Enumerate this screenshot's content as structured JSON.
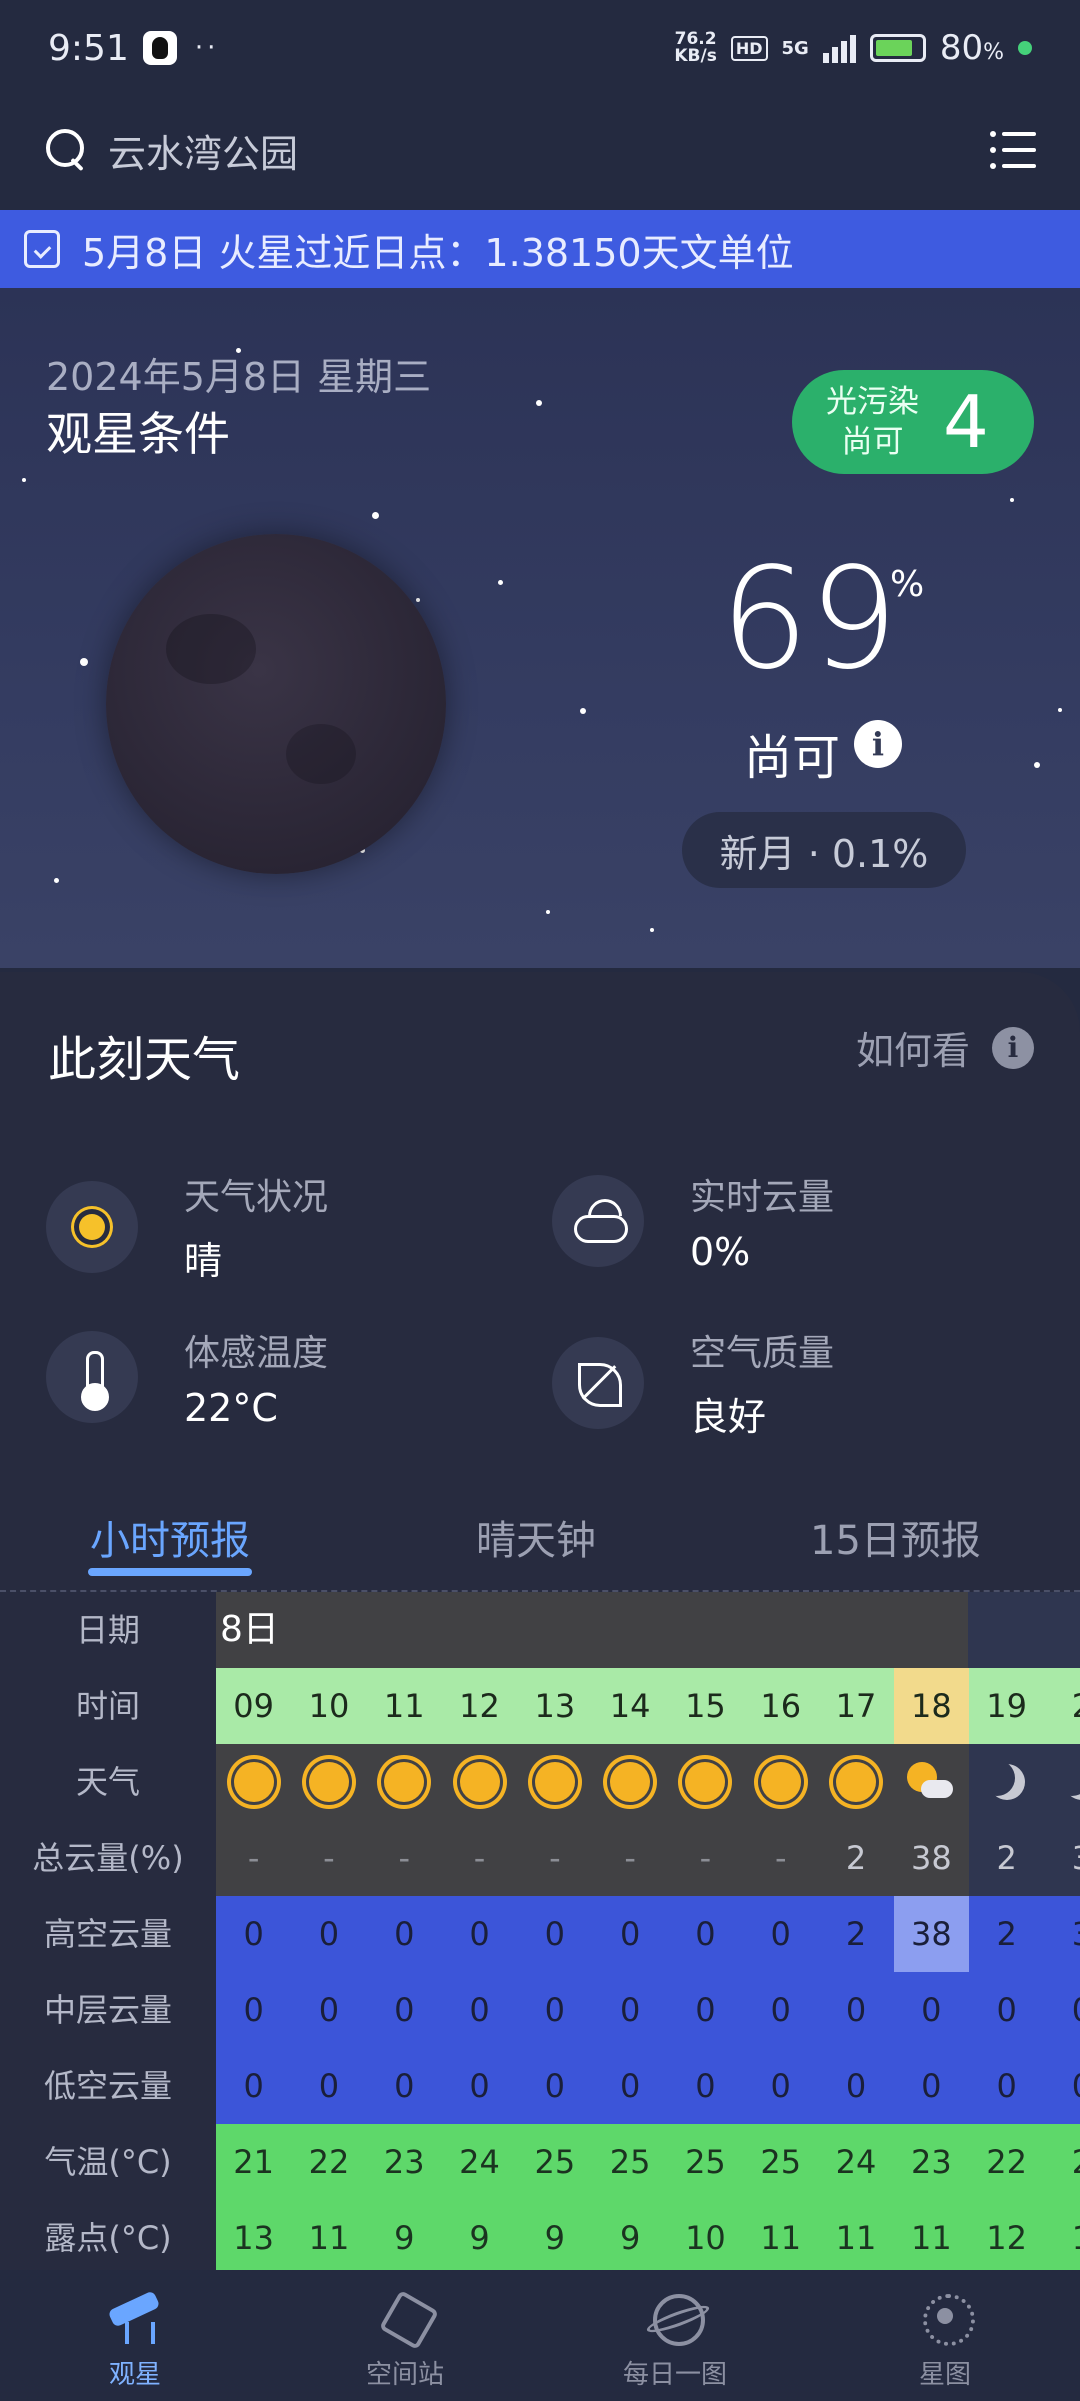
{
  "status_bar": {
    "time": "9:51",
    "dots": "··",
    "net_speed_top": "76.2",
    "net_speed_bottom": "KB/s",
    "hd": "HD",
    "signal": "5G",
    "battery": "80",
    "battery_unit": "%"
  },
  "search": {
    "location": "云水湾公园"
  },
  "banner": {
    "text": "5月8日 火星过近日点：1.38150天文单位"
  },
  "hero": {
    "date": "2024年5月8日 星期三",
    "title": "观星条件",
    "light_pollution_label": "光污染",
    "light_pollution_level": "尚可",
    "light_pollution_value": "4",
    "score": "69",
    "score_unit": "%",
    "score_label": "尚可",
    "info_icon": "i",
    "moon_phase": "新月 · 0.1%"
  },
  "weather": {
    "title": "此刻天气",
    "howto": "如何看",
    "items": [
      {
        "label": "天气状况",
        "value": "晴",
        "icon": "sun-icon"
      },
      {
        "label": "实时云量",
        "value": "0%",
        "icon": "cloud-icon"
      },
      {
        "label": "体感温度",
        "value": "22°C",
        "icon": "thermometer-icon"
      },
      {
        "label": "空气质量",
        "value": "良好",
        "icon": "leaf-icon"
      }
    ]
  },
  "tabs": [
    {
      "label": "小时预报",
      "active": true
    },
    {
      "label": "晴天钟",
      "active": false
    },
    {
      "label": "15日预报",
      "active": false
    }
  ],
  "forecast": {
    "row_labels": [
      "日期",
      "时间",
      "天气",
      "总云量(%)",
      "高空云量",
      "中层云量",
      "低空云量",
      "气温(°C)",
      "露点(°C)"
    ],
    "date": "8日",
    "hours": [
      "09",
      "10",
      "11",
      "12",
      "13",
      "14",
      "15",
      "16",
      "17",
      "18",
      "19",
      "2"
    ],
    "weather": [
      "sun",
      "sun",
      "sun",
      "sun",
      "sun",
      "sun",
      "sun",
      "sun",
      "sun",
      "partly-cloudy",
      "moon",
      "moon"
    ],
    "total_cloud": [
      "-",
      "-",
      "-",
      "-",
      "-",
      "-",
      "-",
      "-",
      "2",
      "38",
      "2",
      "3"
    ],
    "high_cloud": [
      "0",
      "0",
      "0",
      "0",
      "0",
      "0",
      "0",
      "0",
      "2",
      "38",
      "2",
      "3"
    ],
    "mid_cloud": [
      "0",
      "0",
      "0",
      "0",
      "0",
      "0",
      "0",
      "0",
      "0",
      "0",
      "0",
      "0"
    ],
    "low_cloud": [
      "0",
      "0",
      "0",
      "0",
      "0",
      "0",
      "0",
      "0",
      "0",
      "0",
      "0",
      "0"
    ],
    "temperature": [
      "21",
      "22",
      "23",
      "24",
      "25",
      "25",
      "25",
      "25",
      "24",
      "23",
      "22",
      "2"
    ],
    "dew_point": [
      "13",
      "11",
      "9",
      "9",
      "9",
      "9",
      "10",
      "11",
      "11",
      "11",
      "12",
      "1"
    ]
  },
  "bottom_nav": [
    {
      "label": "观星",
      "icon": "telescope-icon",
      "active": true
    },
    {
      "label": "空间站",
      "icon": "space-station-icon",
      "active": false
    },
    {
      "label": "每日一图",
      "icon": "planet-icon",
      "active": false
    },
    {
      "label": "星图",
      "icon": "galaxy-icon",
      "active": false
    }
  ],
  "colors": {
    "background": "#242a40",
    "banner": "#3e5be0",
    "badge_green": "#2bb06b",
    "tab_active": "#6aa6ff",
    "hour_band": "#a9eaa7",
    "hour_highlight": "#f2da8c",
    "cloud_band": "#3c55d9",
    "temp_band": "#5ed86a"
  }
}
